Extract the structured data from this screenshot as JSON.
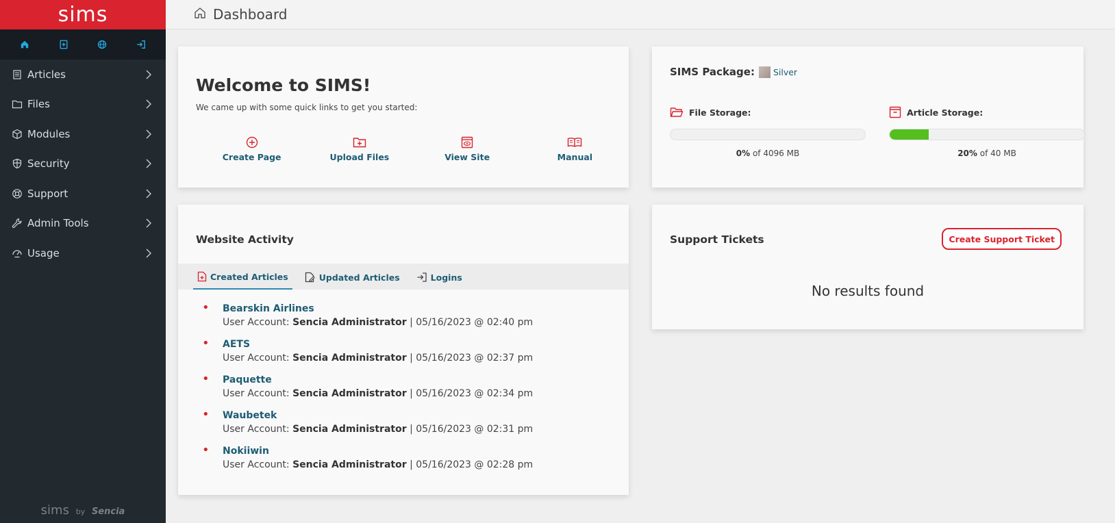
{
  "brand": {
    "logo": "sims"
  },
  "sidebar": {
    "quick_icons": [
      "home-icon",
      "add-page-icon",
      "globe-icon",
      "logout-icon"
    ],
    "items": [
      {
        "label": "Articles",
        "icon": "article-icon"
      },
      {
        "label": "Files",
        "icon": "folder-icon"
      },
      {
        "label": "Modules",
        "icon": "cube-icon"
      },
      {
        "label": "Security",
        "icon": "shield-icon"
      },
      {
        "label": "Support",
        "icon": "lifebuoy-icon"
      },
      {
        "label": "Admin Tools",
        "icon": "wrench-icon"
      },
      {
        "label": "Usage",
        "icon": "gauge-icon"
      }
    ],
    "footer": {
      "logo": "sims",
      "by": "by",
      "company": "Sencia"
    }
  },
  "header": {
    "title": "Dashboard"
  },
  "welcome": {
    "title": "Welcome to SIMS!",
    "subtitle": "We came up with some quick links to get you started:",
    "links": [
      {
        "label": "Create Page"
      },
      {
        "label": "Upload Files"
      },
      {
        "label": "View Site"
      },
      {
        "label": "Manual"
      }
    ]
  },
  "package": {
    "label": "SIMS Package:",
    "value": "Silver",
    "file_storage": {
      "label": "File Storage:",
      "percent_text": "0%",
      "of_text": "of 4096 MB",
      "fraction": 0.0
    },
    "article_storage": {
      "label": "Article Storage:",
      "percent_text": "20%",
      "of_text": "of 40 MB",
      "fraction": 0.2
    }
  },
  "activity": {
    "title": "Website Activity",
    "tabs": [
      {
        "label": "Created Articles"
      },
      {
        "label": "Updated Articles"
      },
      {
        "label": "Logins"
      }
    ],
    "meta_prefix": "User Account:",
    "items": [
      {
        "title": "Bearskin Airlines",
        "user": "Sencia Administrator",
        "date": "| 05/16/2023 @ 02:40 pm"
      },
      {
        "title": "AETS",
        "user": "Sencia Administrator",
        "date": "| 05/16/2023 @ 02:37 pm"
      },
      {
        "title": "Paquette",
        "user": "Sencia Administrator",
        "date": "| 05/16/2023 @ 02:34 pm"
      },
      {
        "title": "Waubetek",
        "user": "Sencia Administrator",
        "date": "| 05/16/2023 @ 02:31 pm"
      },
      {
        "title": "Nokiiwin",
        "user": "Sencia Administrator",
        "date": "| 05/16/2023 @ 02:28 pm"
      }
    ]
  },
  "tickets": {
    "title": "Support Tickets",
    "button": "Create Support Ticket",
    "empty": "No results found"
  },
  "colors": {
    "brand_red": "#d9232e",
    "sidebar_bg": "#222a30",
    "link_blue": "#1d5c74",
    "progress_green": "#54bf1e"
  }
}
